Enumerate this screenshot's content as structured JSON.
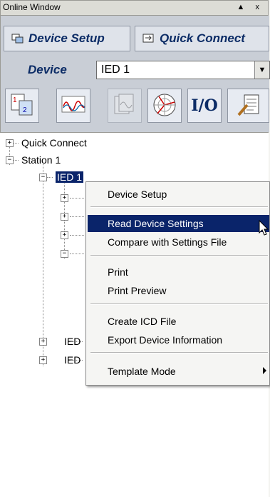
{
  "window": {
    "title": "Online Window",
    "controls": "▲ x"
  },
  "toolbar": {
    "device_setup_label": "Device Setup",
    "quick_connect_label": "Quick Connect"
  },
  "device": {
    "label": "Device",
    "value": "IED 1"
  },
  "icon_buttons": [
    "settings-compare-icon",
    "waveform-icon",
    "records-icon",
    "phasor-icon",
    "io-icon",
    "document-icon"
  ],
  "io_text": "I/O",
  "tree": {
    "quick_connect": "Quick Connect",
    "station": "Station 1",
    "ied_selected": "IED 1",
    "ied_a": "IED",
    "ied_b": "IED"
  },
  "context_menu": {
    "items": [
      "Device Setup",
      "Read Device Settings",
      "Compare with Settings File",
      "Print",
      "Print Preview",
      "Create ICD File",
      "Export Device Information",
      "Template Mode"
    ],
    "highlighted": "Read Device Settings"
  }
}
